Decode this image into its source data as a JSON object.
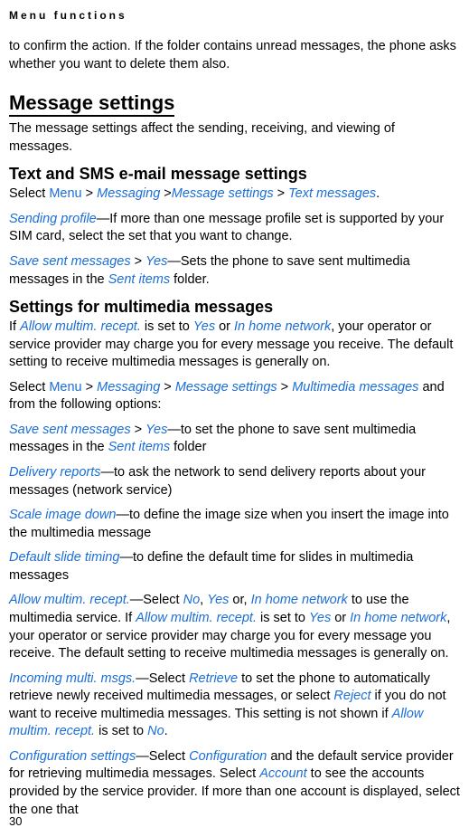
{
  "header": "Menu functions",
  "topPara": "to confirm the action. If the folder contains unread messages, the phone asks whether you want to delete them also.",
  "pageNumber": "30",
  "messageSettings": {
    "heading": "Message settings",
    "intro": "The message settings affect the sending, receiving, and viewing of messages."
  },
  "textSms": {
    "heading": "Text and SMS e-mail message settings",
    "line1": {
      "t1": "Select ",
      "menu": "Menu",
      "gt1": " > ",
      "messaging": "Messaging",
      "gt2": " >",
      "msgSettings": "Message settings",
      "gt3": " > ",
      "textMessages": "Text messages",
      "period": "."
    },
    "sendingProfile": {
      "label": "Sending profile",
      "rest": "—If more than one message profile set is supported by your SIM card, select the set that you want to change."
    },
    "saveSent": {
      "label": "Save sent messages",
      "gt": " > ",
      "yes": "Yes",
      "rest1": "—Sets the phone to save sent multimedia messages in the ",
      "sentItems": "Sent items",
      "rest2": " folder."
    }
  },
  "multimedia": {
    "heading": "Settings for multimedia messages",
    "intro": {
      "t1": "If ",
      "allow": "Allow multim. recept.",
      "t2": " is set to ",
      "yes": "Yes",
      "t3": " or ",
      "inHome": "In home network",
      "t4": ", your operator or service provider may charge you for every message you receive. The default setting to receive multimedia messages is generally on."
    },
    "selectLine": {
      "t1": "Select ",
      "menu": "Menu",
      "gt1": " > ",
      "messaging": "Messaging",
      "gt2": " > ",
      "msgSettings": "Message settings",
      "gt3": " > ",
      "mms": "Multimedia messages",
      "rest": " and from the following options:"
    },
    "saveSent": {
      "label": "Save sent messages",
      "gt": " > ",
      "yes": "Yes",
      "rest1": "—to set the phone to save sent multimedia messages in the ",
      "sentItems": "Sent items",
      "rest2": " folder"
    },
    "delivery": {
      "label": "Delivery reports",
      "rest": "—to ask the network to send delivery reports about your messages (network service)"
    },
    "scale": {
      "label": "Scale image down",
      "rest": "—to define the image size when you insert the image into the multimedia message"
    },
    "defaultSlide": {
      "label": "Default slide timing",
      "rest": "—to define the default time for slides in multimedia messages"
    },
    "allowRecept": {
      "label": "Allow multim. recept.",
      "t1": "—Select ",
      "no": "No",
      "comma1": ", ",
      "yes": "Yes",
      "t2": " or, ",
      "inHome": "In home network",
      "t3": " to use the multimedia service. If ",
      "allow": "Allow multim. recept.",
      "t4": " is set to ",
      "yes2": "Yes",
      "t5": " or ",
      "inHome2": "In home network",
      "t6": ", your operator or service provider may charge you for every message you receive. The default setting to receive multimedia messages is generally on."
    },
    "incoming": {
      "label": "Incoming multi. msgs.",
      "t1": "—Select ",
      "retrieve": "Retrieve",
      "t2": " to set the phone to automatically retrieve newly received multimedia messages, or select ",
      "reject": "Reject",
      "t3": " if you do not want to receive multimedia messages. This setting is not shown if ",
      "allow": "Allow multim. recept.",
      "t4": " is set to ",
      "no": "No",
      "period": "."
    },
    "config": {
      "label": "Configuration settings",
      "t1": "—Select ",
      "configuration": "Configuration",
      "t2": " and the default service provider for retrieving multimedia messages. Select ",
      "account": "Account",
      "t3": " to see the accounts provided by the service provider. If more than one account is displayed, select the one that"
    }
  }
}
